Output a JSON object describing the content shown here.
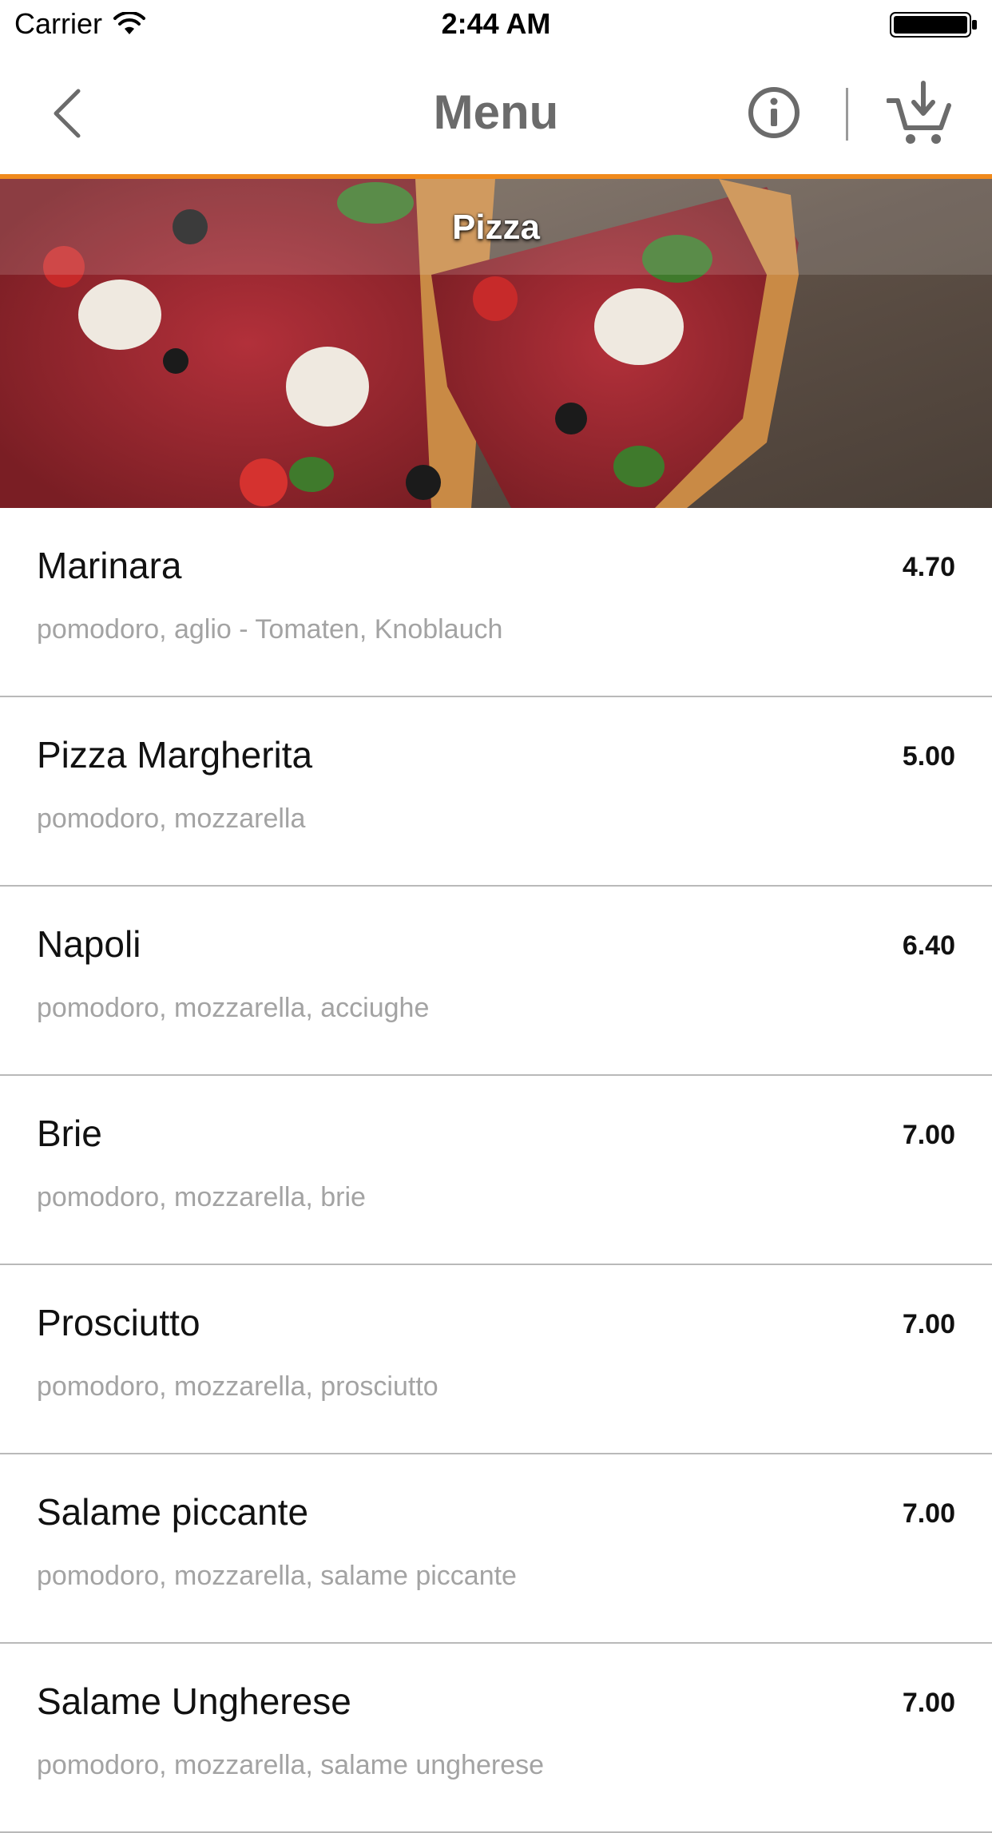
{
  "status_bar": {
    "carrier": "Carrier",
    "time": "2:44 AM"
  },
  "nav": {
    "title": "Menu",
    "back_icon": "chevron-left-icon",
    "info_icon": "info-icon",
    "cart_icon": "cart-add-icon"
  },
  "colors": {
    "accent": "#f08a1c",
    "title_gray": "#6b6b6b",
    "description_gray": "#a3a3a3",
    "divider": "#b9b9b9"
  },
  "category": {
    "title": "Pizza"
  },
  "menu_items": [
    {
      "name": "Marinara",
      "price": "4.70",
      "description": "pomodoro, aglio - Tomaten, Knoblauch"
    },
    {
      "name": "Pizza Margherita",
      "price": "5.00",
      "description": "pomodoro, mozzarella"
    },
    {
      "name": "Napoli",
      "price": "6.40",
      "description": "pomodoro, mozzarella, acciughe"
    },
    {
      "name": "Brie",
      "price": "7.00",
      "description": "pomodoro, mozzarella, brie"
    },
    {
      "name": "Prosciutto",
      "price": "7.00",
      "description": "pomodoro, mozzarella, prosciutto"
    },
    {
      "name": "Salame piccante",
      "price": "7.00",
      "description": "pomodoro, mozzarella, salame piccante"
    },
    {
      "name": "Salame Ungherese",
      "price": "7.00",
      "description": "pomodoro, mozzarella, salame ungherese"
    }
  ]
}
